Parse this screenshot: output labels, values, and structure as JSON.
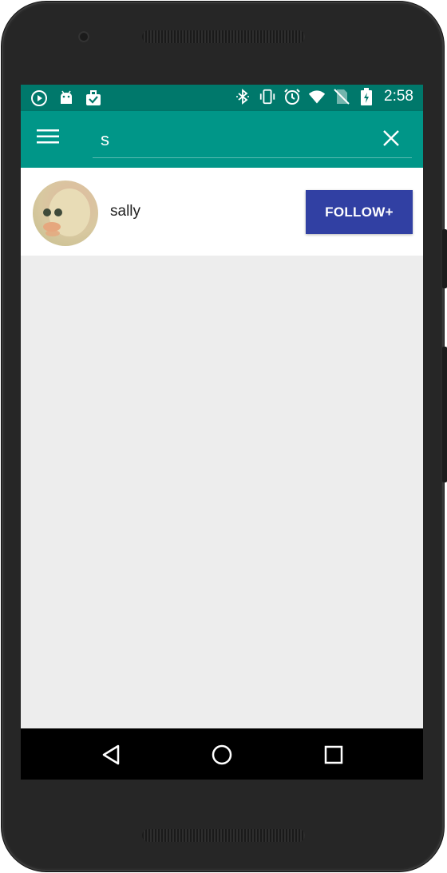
{
  "status_bar": {
    "time": "2:58",
    "left_icons": [
      "play-icon",
      "android-icon",
      "briefcase-check-icon"
    ],
    "right_icons": [
      "bluetooth-icon",
      "vibrate-icon",
      "alarm-icon",
      "wifi-icon",
      "no-sim-icon",
      "battery-charging-icon"
    ],
    "color": "#00786b"
  },
  "app_bar": {
    "color": "#009688",
    "menu_icon": "hamburger-menu-icon",
    "search": {
      "value": "s"
    },
    "clear_icon": "close-icon"
  },
  "results": [
    {
      "username": "sally",
      "follow_label": "FOLLOW+",
      "avatar_icon": "avatar-image"
    }
  ],
  "nav_bar": {
    "back_icon": "back-icon",
    "home_icon": "home-icon",
    "recent_icon": "recent-apps-icon"
  },
  "colors": {
    "accent_button": "#3140a3",
    "background": "#ededed"
  }
}
